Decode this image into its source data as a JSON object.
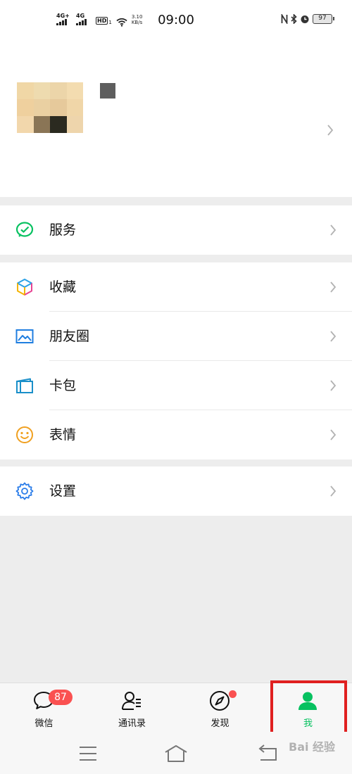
{
  "status_bar": {
    "net1": "4G+",
    "net2": "4G",
    "hd": "HD",
    "hd_sub": "1",
    "speed_value": "3.10",
    "speed_unit": "KB/s",
    "time": "09:00",
    "battery": "97"
  },
  "menu": {
    "services": "服务",
    "favorites": "收藏",
    "moments": "朋友圈",
    "cards": "卡包",
    "stickers": "表情",
    "settings": "设置"
  },
  "tabbar": {
    "chats": "微信",
    "chats_badge": "87",
    "contacts": "通讯录",
    "discover": "发现",
    "me": "我"
  },
  "watermark": "Bai 经验",
  "colors": {
    "accent_green": "#07c160",
    "badge_red": "#fa5151",
    "highlight_red": "#e02020",
    "background": "#ededed"
  }
}
